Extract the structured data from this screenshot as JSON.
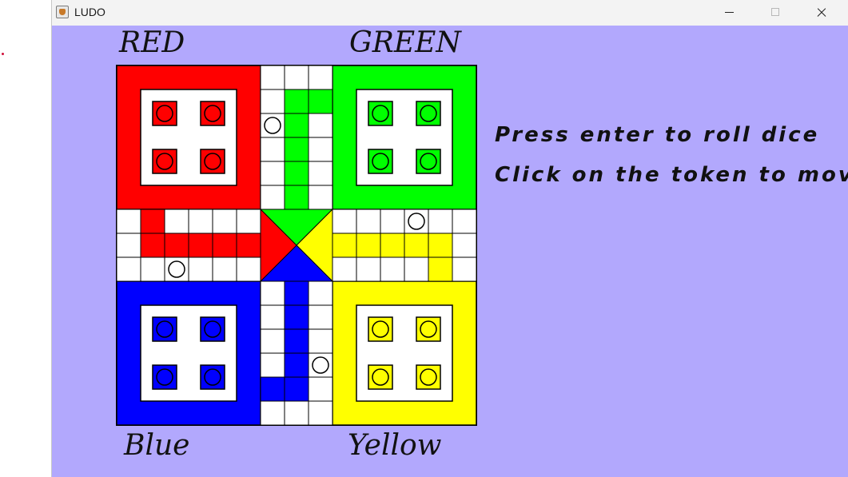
{
  "window": {
    "title": "LUDO",
    "icon": "java-cup-icon",
    "controls": [
      "minimize-icon",
      "maximize-icon",
      "close-icon"
    ]
  },
  "board": {
    "labels": {
      "red": "RED",
      "green": "GREEN",
      "blue": "Blue",
      "yellow": "Yellow"
    },
    "colors": {
      "red": "#ff0000",
      "green": "#00ff00",
      "blue": "#0000ff",
      "yellow": "#ffff00",
      "background": "#b2a8fd"
    },
    "tokens": {
      "red": 4,
      "green": 4,
      "blue": 4,
      "yellow": 4
    },
    "safe_cells": 4
  },
  "instructions": {
    "line1": "Press enter to roll dice",
    "line2": "Click on the token to move"
  }
}
